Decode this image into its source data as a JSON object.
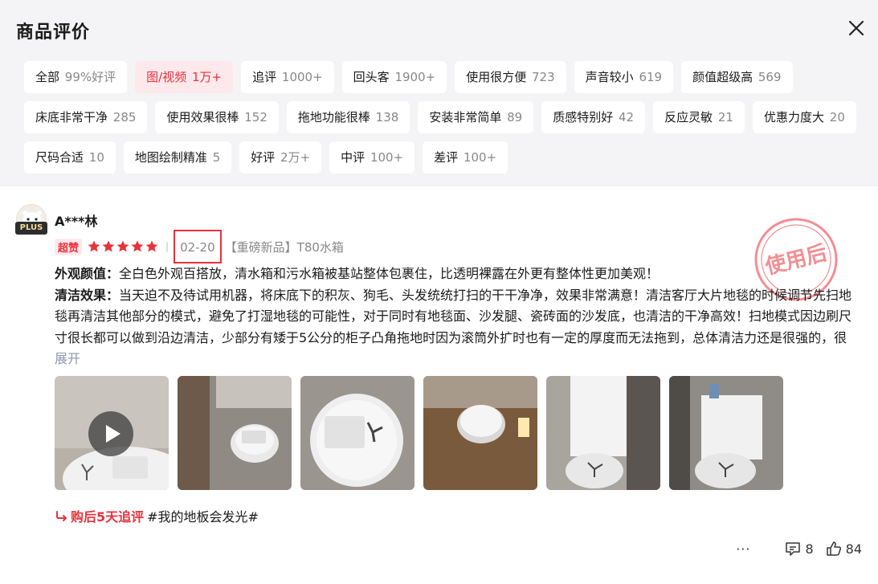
{
  "header": {
    "title": "商品评价"
  },
  "tags": [
    [
      {
        "label": "全部",
        "count": "99%好评",
        "active": false
      },
      {
        "label": "图/视频",
        "count": "1万+",
        "active": true
      },
      {
        "label": "追评",
        "count": "1000+",
        "active": false
      },
      {
        "label": "回头客",
        "count": "1900+",
        "active": false
      },
      {
        "label": "使用很方便",
        "count": "723",
        "active": false
      },
      {
        "label": "声音较小",
        "count": "619",
        "active": false
      },
      {
        "label": "颜值超级高",
        "count": "569",
        "active": false
      }
    ],
    [
      {
        "label": "床底非常干净",
        "count": "285",
        "active": false
      },
      {
        "label": "使用效果很棒",
        "count": "152",
        "active": false
      },
      {
        "label": "拖地功能很棒",
        "count": "138",
        "active": false
      },
      {
        "label": "安装非常简单",
        "count": "89",
        "active": false
      },
      {
        "label": "质感特别好",
        "count": "42",
        "active": false
      },
      {
        "label": "反应灵敏",
        "count": "21",
        "active": false
      },
      {
        "label": "优惠力度大",
        "count": "20",
        "active": false
      }
    ],
    [
      {
        "label": "尺码合适",
        "count": "10",
        "active": false
      },
      {
        "label": "地图绘制精准",
        "count": "5",
        "active": false
      },
      {
        "label": "好评",
        "count": "2万+",
        "active": false
      },
      {
        "label": "中评",
        "count": "100+",
        "active": false
      },
      {
        "label": "差评",
        "count": "100+",
        "active": false
      }
    ]
  ],
  "review": {
    "user": "A***林",
    "plus": "PLUS",
    "badge": "超赞",
    "rating": 5,
    "date": "02-20",
    "product": "【重磅新品】T80水箱",
    "stamp": "使用后",
    "para1_label": "外观颜值：",
    "para1_text": "全白色外观百搭放，清水箱和污水箱被基站整体包裹住，比透明裸露在外更有整体性更加美观！",
    "para2_label": "清洁效果：",
    "para2_text": "当天迫不及待试用机器，将床底下的积灰、狗毛、头发统统打扫的干干净净，效果非常满意！清洁客厅大片地毯的时候调节先扫地毯再清洁其他部分的模式，避免了打湿地毯的可能性，对于同时有地毯面、沙发腿、瓷砖面的沙发底，也清洁的干净高效！扫地模式因边刷尺寸很长都可以做到沿边清洁，少部分有矮于5公分的柜子凸角拖地时因为滚筒外扩时也有一定的厚度而无法拖到，总体清洁力还是很强的，很",
    "expand": "展开",
    "followup_label": "购后5天追评",
    "followup_text": "#我的地板会发光#",
    "more": "···",
    "comments": "8",
    "likes": "84"
  },
  "colors": {
    "accent": "#e8323c",
    "header_bg": "#f4f4f6",
    "active_tag_bg": "#fde8ec"
  },
  "icons": [
    "close-icon",
    "star-icon",
    "play-icon",
    "comment-icon",
    "thumbs-up-icon",
    "followup-arrow-icon"
  ]
}
